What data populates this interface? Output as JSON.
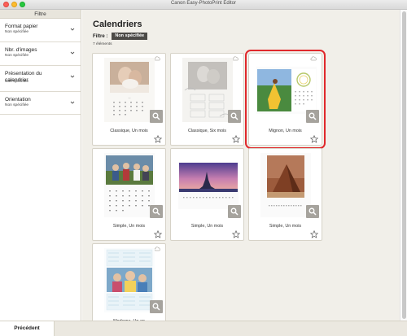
{
  "window": {
    "title": "Canon Easy-PhotoPrint Editor"
  },
  "sidebar": {
    "header": "Filtre",
    "items": [
      {
        "title": "Format papier",
        "value": "Non spécifiée"
      },
      {
        "title": "Nbr. d'images",
        "value": "Non spécifiée"
      },
      {
        "title": "Présentation du calendrier",
        "value": "Non spécifiée"
      },
      {
        "title": "Orientation",
        "value": "Non spécifiée"
      }
    ]
  },
  "main": {
    "title": "Calendriers",
    "filter_label": "Filtre :",
    "filter_value": "Non spécifiée",
    "count": "7 éléments"
  },
  "cards": [
    {
      "label": "Classique, Un mois",
      "selected": false
    },
    {
      "label": "Classique, Six mois",
      "selected": false
    },
    {
      "label": "Mignon, Un mois",
      "selected": true
    },
    {
      "label": "Simple, Un mois",
      "selected": false
    },
    {
      "label": "Simple, Un mois",
      "selected": false
    },
    {
      "label": "Simple, Un mois",
      "selected": false
    },
    {
      "label": "Moderne, Un an",
      "selected": false
    }
  ],
  "footer": {
    "back_label": "Précédent"
  },
  "colors": {
    "selection": "#e0292c",
    "tag_bg": "#4c4a47",
    "content_bg": "#f1efe9"
  }
}
